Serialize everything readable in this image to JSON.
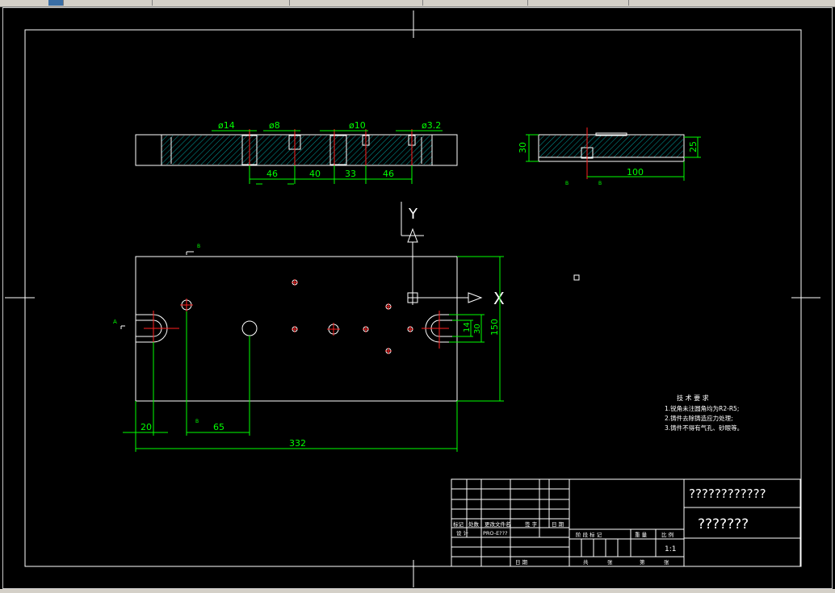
{
  "window": {
    "accent": "#3a6ea5",
    "background": "#000000"
  },
  "dimensions": {
    "phi14": "ø14",
    "phi8": "ø8",
    "phi10": "ø10",
    "phi3_2": "ø3.2",
    "d46a": "46",
    "d40": "40",
    "d33": "33",
    "d46b": "46",
    "d30": "30",
    "d25": "25",
    "d100": "100",
    "d14": "14",
    "d30b": "30",
    "d150": "150",
    "d20": "20",
    "d65": "65",
    "d332": "332"
  },
  "axes": {
    "y": "Y",
    "x": "X"
  },
  "section_marks": {
    "a": "A",
    "b": "B"
  },
  "tech_req": {
    "title": "技 术 要 求",
    "line1": "1.锐角未注圆角均为R2-R5;",
    "line2": "2.铸件去除铸造应力处理;",
    "line3": "3.铸件不得有气孔、砂眼等。"
  },
  "title_block": {
    "title_top": "????????????",
    "title_bottom": "???????",
    "h_mark": "标记",
    "h_count": "处数",
    "h_doc": "更改文件名",
    "h_sign": "签 字",
    "h_date": "日 期",
    "design": "设 计",
    "designer": "PRO-E???",
    "date2": "日 期",
    "stage": "阶 段 标 记",
    "weight": "重 量",
    "scale_label": "比 例",
    "scale": "1:1",
    "total": "共",
    "sheets": "张",
    "sheet_no": "第",
    "sheet_end": "张"
  }
}
